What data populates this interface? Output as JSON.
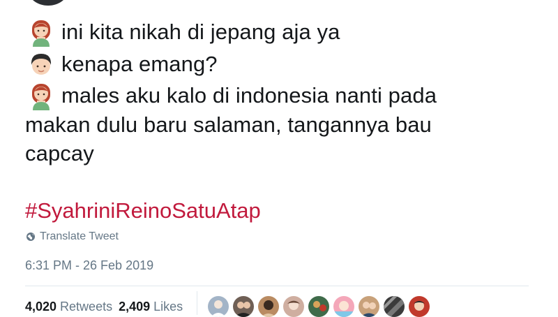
{
  "tweet": {
    "lines": [
      {
        "emoji": "woman-emoji",
        "text": "ini kita nikah di jepang aja ya"
      },
      {
        "emoji": "man-emoji",
        "text": "kenapa emang?"
      },
      {
        "emoji": "woman-emoji",
        "text": "males aku kalo di indonesia nanti pada"
      },
      {
        "emoji": "",
        "text": "makan dulu baru salaman, tangannya bau"
      },
      {
        "emoji": "",
        "text": "capcay"
      }
    ],
    "hashtag": "#SyahriniReinoSatuAtap",
    "translate_label": "Translate Tweet",
    "timestamp": "6:31 PM - 26 Feb 2019"
  },
  "stats": {
    "retweets_count": "4,020",
    "retweets_label": "Retweets",
    "likes_count": "2,409",
    "likes_label": "Likes"
  },
  "likers": [
    {
      "name": "liker-avatar-1",
      "color": "#a3b4c7"
    },
    {
      "name": "liker-avatar-2",
      "color": "#6f5f55"
    },
    {
      "name": "liker-avatar-3",
      "color": "#b98b62"
    },
    {
      "name": "liker-avatar-4",
      "color": "#cfaea0"
    },
    {
      "name": "liker-avatar-5",
      "color": "#3f6b4a"
    },
    {
      "name": "liker-avatar-6",
      "color": "#f4a7b9"
    },
    {
      "name": "liker-avatar-7",
      "color": "#c8a17a"
    },
    {
      "name": "liker-avatar-8",
      "color": "#3b3b3b"
    },
    {
      "name": "liker-avatar-9",
      "color": "#c0392b"
    }
  ],
  "colors": {
    "hashtag": "#c1193c",
    "secondary_text": "#657786",
    "primary_text": "#14171a",
    "divider": "#e1e8ed"
  }
}
